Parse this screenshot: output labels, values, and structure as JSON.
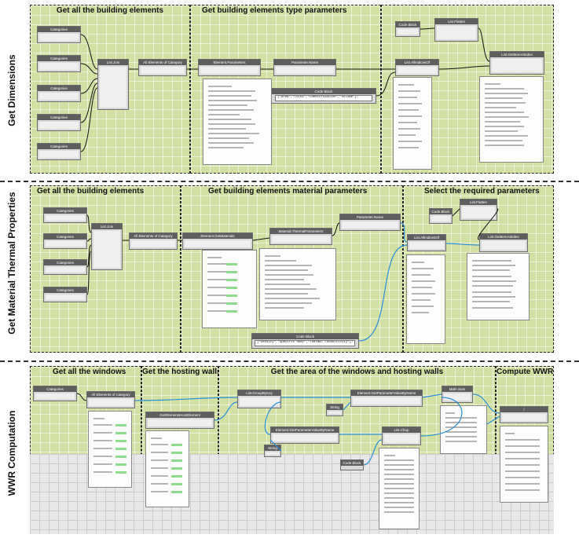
{
  "rows": [
    {
      "label": "Get Dimensions"
    },
    {
      "label": "Get Material Thermal Properties"
    },
    {
      "label": "WWR Computation"
    }
  ],
  "groups": {
    "r1g1": "Get all the building elements",
    "r1g2": "Get building elements type parameters",
    "r2g1": "Get all the building elements",
    "r2g2": "Get building elements material parameters",
    "r2g3": "Select the required parameters",
    "r3g1": "Get all the windows",
    "r3g2": "Get the hosting walls",
    "r3g3": "Get the area of the windows and hosting walls",
    "r3g4": "Compute WWR"
  },
  "nodes": {
    "categories": "Categories",
    "list_join": "List.Join",
    "all_elements": "All Elements of Category",
    "element_parameters": "Element.Parameters",
    "parameter_name": "Parameter.Name",
    "code_block": "Code Block",
    "list_allindices": "List.AllIndicesOf",
    "list_flatten": "List.Flatten",
    "list_getitem": "List.GetItemAtIndex",
    "element_getmaterial": "Element.GetMaterials",
    "material_thermal": "Material.ThermalParameters",
    "list_groupbykey": "List.GroupByKey",
    "get_param_value": "Element.GetParameterValueByName",
    "string": "String",
    "list_chop": "List.Chop",
    "math_sum": "Math.Sum",
    "get_hosting_element": "GetElementsHostElement"
  },
  "code": {
    "r1": "{\"Area\",\"Thick\",\"Identification\",\"Volume\"};",
    "r2": "{\"Density\",\"Specific Heat\",\"Thermal Conductivity\"};"
  }
}
